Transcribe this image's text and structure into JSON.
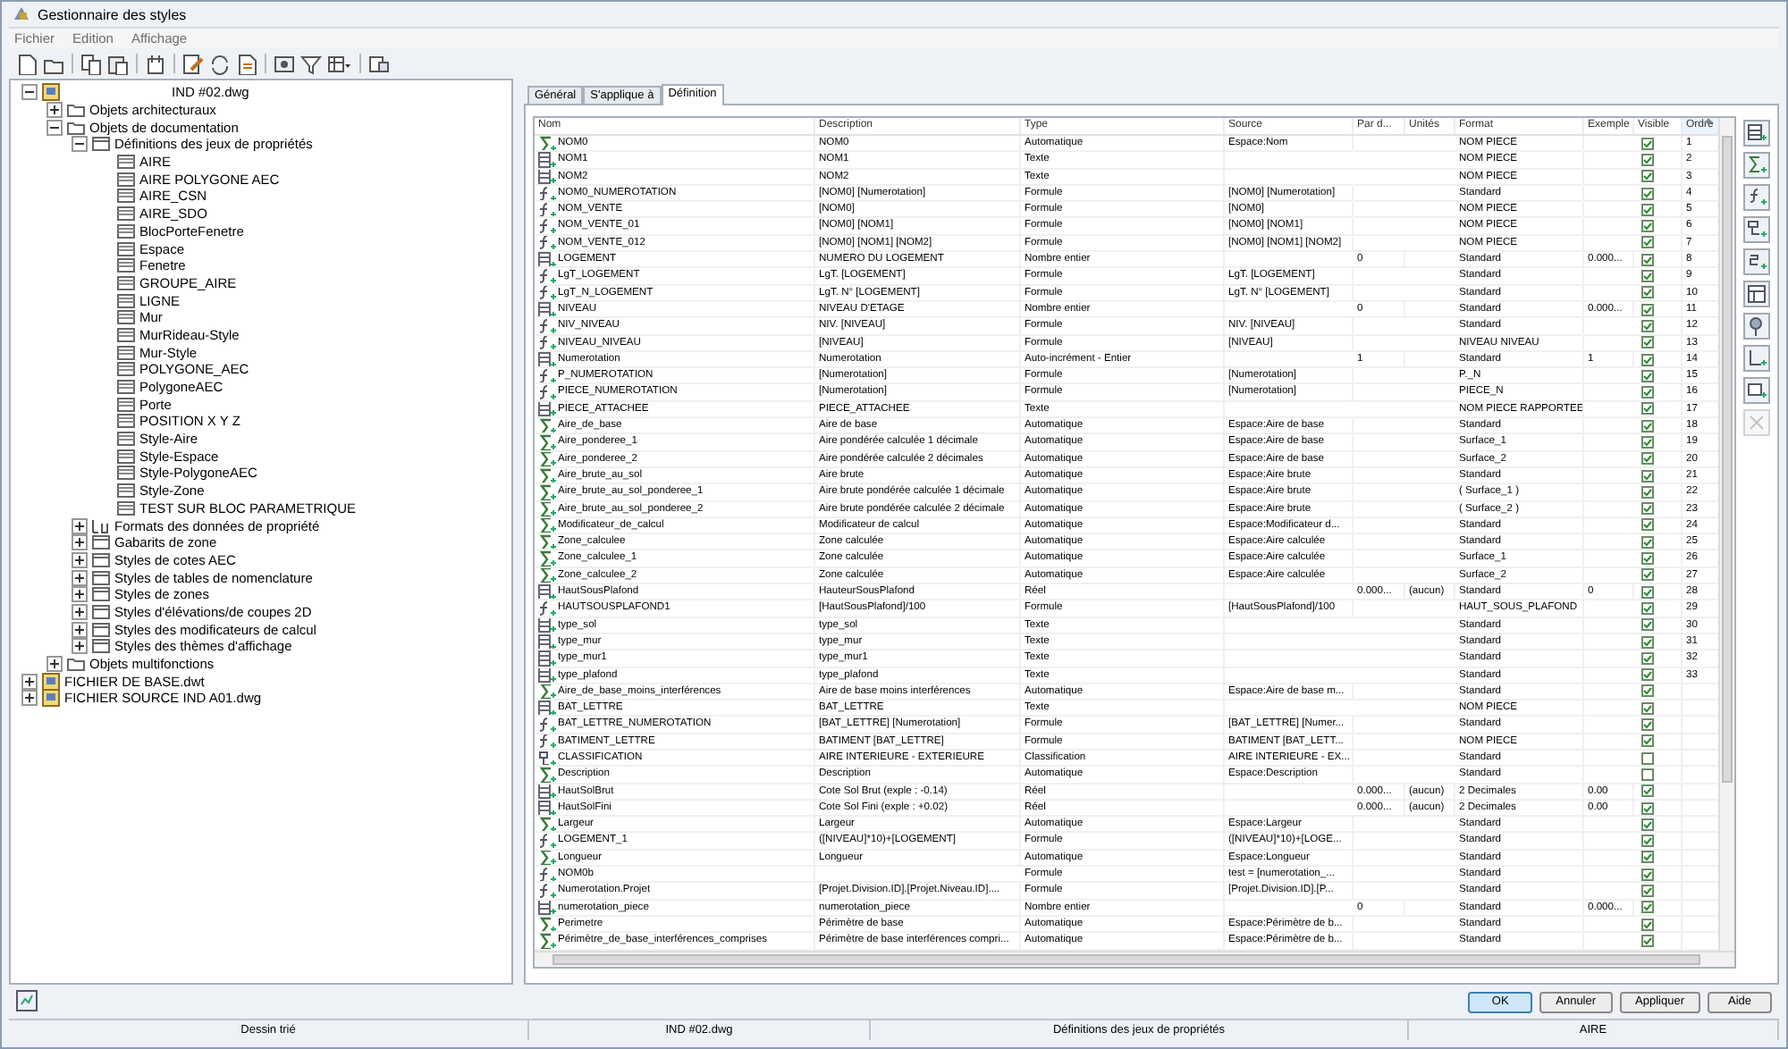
{
  "window": {
    "title": "Gestionnaire des styles"
  },
  "menu": [
    "Fichier",
    "Edition",
    "Affichage"
  ],
  "tree": [
    {
      "label": "IND #02.dwg",
      "kind": "drawing",
      "expanded": true,
      "children": [
        {
          "label": "Objets architecturaux",
          "kind": "folder",
          "expanded": false
        },
        {
          "label": "Objets de documentation",
          "kind": "folder",
          "expanded": true,
          "children": [
            {
              "label": "Définitions des jeux de propriétés",
              "kind": "category",
              "expanded": true,
              "children": [
                {
                  "label": "AIRE",
                  "kind": "item"
                },
                {
                  "label": "AIRE POLYGONE AEC",
                  "kind": "item"
                },
                {
                  "label": "AIRE_CSN",
                  "kind": "item"
                },
                {
                  "label": "AIRE_SDO",
                  "kind": "item"
                },
                {
                  "label": "BlocPorteFenetre",
                  "kind": "item"
                },
                {
                  "label": "Espace",
                  "kind": "item"
                },
                {
                  "label": "Fenetre",
                  "kind": "item"
                },
                {
                  "label": "GROUPE_AIRE",
                  "kind": "item"
                },
                {
                  "label": "LIGNE",
                  "kind": "item"
                },
                {
                  "label": "Mur",
                  "kind": "item"
                },
                {
                  "label": "MurRideau-Style",
                  "kind": "item"
                },
                {
                  "label": "Mur-Style",
                  "kind": "item"
                },
                {
                  "label": "POLYGONE_AEC",
                  "kind": "item"
                },
                {
                  "label": "PolygoneAEC",
                  "kind": "item"
                },
                {
                  "label": "Porte",
                  "kind": "item"
                },
                {
                  "label": "POSITION X Y Z",
                  "kind": "item"
                },
                {
                  "label": "Style-Aire",
                  "kind": "item"
                },
                {
                  "label": "Style-Espace",
                  "kind": "item"
                },
                {
                  "label": "Style-PolygoneAEC",
                  "kind": "item"
                },
                {
                  "label": "Style-Zone",
                  "kind": "item"
                },
                {
                  "label": "TEST SUR BLOC PARAMETRIQUE",
                  "kind": "item"
                }
              ]
            },
            {
              "label": "Formats des données de propriété",
              "kind": "format",
              "expanded": false
            },
            {
              "label": "Gabarits de zone",
              "kind": "category",
              "expanded": false
            },
            {
              "label": "Styles de cotes AEC",
              "kind": "category",
              "expanded": false
            },
            {
              "label": "Styles de tables de nomenclature",
              "kind": "category",
              "expanded": false
            },
            {
              "label": "Styles de zones",
              "kind": "category",
              "expanded": false
            },
            {
              "label": "Styles d'élévations/de coupes 2D",
              "kind": "category",
              "expanded": false
            },
            {
              "label": "Styles des modificateurs de calcul",
              "kind": "category",
              "expanded": false
            },
            {
              "label": "Styles des thèmes d'affichage",
              "kind": "category",
              "expanded": false
            }
          ]
        },
        {
          "label": "Objets multifonctions",
          "kind": "folder",
          "expanded": false
        }
      ]
    },
    {
      "label": "FICHIER DE BASE.dwt",
      "kind": "drawing",
      "expanded": false
    },
    {
      "label": "FICHIER SOURCE IND A01.dwg",
      "kind": "drawing",
      "expanded": false
    }
  ],
  "tabs": [
    {
      "label": "Général",
      "selected": false
    },
    {
      "label": "S'applique à",
      "selected": false
    },
    {
      "label": "Définition",
      "selected": true
    }
  ],
  "table": {
    "columns": [
      {
        "label": "Nom",
        "sorted": false
      },
      {
        "label": "Description",
        "sorted": false
      },
      {
        "label": "Type",
        "sorted": false
      },
      {
        "label": "Source",
        "sorted": false
      },
      {
        "label": "Par d...",
        "sorted": false
      },
      {
        "label": "Unités",
        "sorted": false
      },
      {
        "label": "Format",
        "sorted": false
      },
      {
        "label": "Exemple",
        "sorted": false
      },
      {
        "label": "Visible",
        "sorted": false
      },
      {
        "label": "Ordre",
        "sorted": true
      }
    ],
    "rows": [
      {
        "kind": "automatic",
        "name": "NOM0",
        "description": "NOM0",
        "type": "Automatique",
        "source": "Espace:Nom",
        "format": "NOM PIECE",
        "visible": true,
        "order": "1"
      },
      {
        "kind": "manual",
        "name": "NOM1",
        "description": "NOM1",
        "type": "Texte",
        "format": "NOM PIECE",
        "visible": true,
        "order": "2"
      },
      {
        "kind": "manual",
        "name": "NOM2",
        "description": "NOM2",
        "type": "Texte",
        "format": "NOM PIECE",
        "visible": true,
        "order": "3"
      },
      {
        "kind": "formula",
        "name": "NOM0_NUMEROTATION",
        "description": "[NOM0] [Numerotation]",
        "type": "Formule",
        "source": "[NOM0] [Numerotation]",
        "format": "Standard",
        "visible": true,
        "order": "4"
      },
      {
        "kind": "formula",
        "name": "NOM_VENTE",
        "description": "[NOM0]",
        "type": "Formule",
        "source": "[NOM0]",
        "format": "NOM PIECE",
        "visible": true,
        "order": "5"
      },
      {
        "kind": "formula",
        "name": "NOM_VENTE_01",
        "description": "[NOM0] [NOM1]",
        "type": "Formule",
        "source": "[NOM0] [NOM1]",
        "format": "NOM PIECE",
        "visible": true,
        "order": "6"
      },
      {
        "kind": "formula",
        "name": "NOM_VENTE_012",
        "description": "[NOM0] [NOM1] [NOM2]",
        "type": "Formule",
        "source": "[NOM0] [NOM1] [NOM2]",
        "format": "NOM PIECE",
        "visible": true,
        "order": "7"
      },
      {
        "kind": "manual",
        "name": "LOGEMENT",
        "description": "NUMERO DU LOGEMENT",
        "type": "Nombre entier",
        "default": "0",
        "format": "Standard",
        "example": "0.000...",
        "visible": true,
        "order": "8"
      },
      {
        "kind": "formula",
        "name": "LgT_LOGEMENT",
        "description": "LgT. [LOGEMENT]",
        "type": "Formule",
        "source": "LgT. [LOGEMENT]",
        "format": "Standard",
        "visible": true,
        "order": "9"
      },
      {
        "kind": "formula",
        "name": "LgT_N_LOGEMENT",
        "description": "LgT. N° [LOGEMENT]",
        "type": "Formule",
        "source": "LgT. N° [LOGEMENT]",
        "format": "Standard",
        "visible": true,
        "order": "10"
      },
      {
        "kind": "manual",
        "name": "NIVEAU",
        "description": "NIVEAU D'ETAGE",
        "type": "Nombre entier",
        "default": "0",
        "format": "Standard",
        "example": "0.000...",
        "visible": true,
        "order": "11"
      },
      {
        "kind": "formula",
        "name": "NIV_NIVEAU",
        "description": "NIV. [NIVEAU]",
        "type": "Formule",
        "source": "NIV. [NIVEAU]",
        "format": "Standard",
        "visible": true,
        "order": "12"
      },
      {
        "kind": "formula",
        "name": "NIVEAU_NIVEAU",
        "description": "[NIVEAU]",
        "type": "Formule",
        "source": "[NIVEAU]",
        "format": "NIVEAU NIVEAU",
        "visible": true,
        "order": "13"
      },
      {
        "kind": "manual",
        "name": "Numerotation",
        "description": "Numerotation",
        "type": "Auto-incrément - Entier",
        "default": "1",
        "format": "Standard",
        "example": "1",
        "visible": true,
        "order": "14"
      },
      {
        "kind": "formula",
        "name": "P_NUMEROTATION",
        "description": "[Numerotation]",
        "type": "Formule",
        "source": "[Numerotation]",
        "format": "P._N",
        "visible": true,
        "order": "15"
      },
      {
        "kind": "formula",
        "name": "PIECE_NUMEROTATION",
        "description": "[Numerotation]",
        "type": "Formule",
        "source": "[Numerotation]",
        "format": "PIECE_N",
        "visible": true,
        "order": "16"
      },
      {
        "kind": "manual",
        "name": "PIECE_ATTACHEE",
        "description": "PIECE_ATTACHEE",
        "type": "Texte",
        "format": "NOM PIECE RAPPORTEE",
        "visible": true,
        "order": "17"
      },
      {
        "kind": "automatic",
        "name": "Aire_de_base",
        "description": "Aire de base",
        "type": "Automatique",
        "source": "Espace:Aire de base",
        "format": "Standard",
        "visible": true,
        "order": "18"
      },
      {
        "kind": "automatic",
        "name": "Aire_ponderee_1",
        "description": "Aire pondérée calculée 1 décimale",
        "type": "Automatique",
        "source": "Espace:Aire de base",
        "format": "Surface_1",
        "visible": true,
        "order": "19"
      },
      {
        "kind": "automatic",
        "name": "Aire_ponderee_2",
        "description": "Aire pondérée calculée 2 décimales",
        "type": "Automatique",
        "source": "Espace:Aire de base",
        "format": "Surface_2",
        "visible": true,
        "order": "20"
      },
      {
        "kind": "automatic",
        "name": "Aire_brute_au_sol",
        "description": "Aire brute",
        "type": "Automatique",
        "source": "Espace:Aire brute",
        "format": "Standard",
        "visible": true,
        "order": "21"
      },
      {
        "kind": "automatic",
        "name": "Aire_brute_au_sol_ponderee_1",
        "description": "Aire brute pondérée calculée 1 décimale",
        "type": "Automatique",
        "source": "Espace:Aire brute",
        "format": "( Surface_1 )",
        "visible": true,
        "order": "22"
      },
      {
        "kind": "automatic",
        "name": "Aire_brute_au_sol_ponderee_2",
        "description": "Aire brute pondérée calculée 2 décimale",
        "type": "Automatique",
        "source": "Espace:Aire brute",
        "format": "( Surface_2 )",
        "visible": true,
        "order": "23"
      },
      {
        "kind": "automatic",
        "name": "Modificateur_de_calcul",
        "description": "Modificateur de calcul",
        "type": "Automatique",
        "source": "Espace:Modificateur d...",
        "format": "Standard",
        "visible": true,
        "order": "24"
      },
      {
        "kind": "automatic",
        "name": "Zone_calculee",
        "description": "Zone calculée",
        "type": "Automatique",
        "source": "Espace:Aire calculée",
        "format": "Standard",
        "visible": true,
        "order": "25"
      },
      {
        "kind": "automatic",
        "name": "Zone_calculee_1",
        "description": "Zone calculée",
        "type": "Automatique",
        "source": "Espace:Aire calculée",
        "format": "Surface_1",
        "visible": true,
        "order": "26"
      },
      {
        "kind": "automatic",
        "name": "Zone_calculee_2",
        "description": "Zone calculée",
        "type": "Automatique",
        "source": "Espace:Aire calculée",
        "format": "Surface_2",
        "visible": true,
        "order": "27"
      },
      {
        "kind": "manual",
        "name": "HautSousPlafond",
        "description": "HauteurSousPlafond",
        "type": "Réel",
        "default": "0.000...",
        "units": "(aucun)",
        "format": "Standard",
        "example": "0",
        "visible": true,
        "order": "28"
      },
      {
        "kind": "formula",
        "name": "HAUTSOUSPLAFOND1",
        "description": "[HautSousPlafond]/100",
        "type": "Formule",
        "source": "[HautSousPlafond]/100",
        "format": "HAUT_SOUS_PLAFOND",
        "visible": true,
        "order": "29"
      },
      {
        "kind": "manual",
        "name": "type_sol",
        "description": "type_sol",
        "type": "Texte",
        "format": "Standard",
        "visible": true,
        "order": "30"
      },
      {
        "kind": "manual",
        "name": "type_mur",
        "description": "type_mur",
        "type": "Texte",
        "format": "Standard",
        "visible": true,
        "order": "31"
      },
      {
        "kind": "manual",
        "name": "type_mur1",
        "description": "type_mur1",
        "type": "Texte",
        "format": "Standard",
        "visible": true,
        "order": "32"
      },
      {
        "kind": "manual",
        "name": "type_plafond",
        "description": "type_plafond",
        "type": "Texte",
        "format": "Standard",
        "visible": true,
        "order": "33"
      },
      {
        "kind": "automatic",
        "name": "Aire_de_base_moins_interférences",
        "description": "Aire de base moins interférences",
        "type": "Automatique",
        "source": "Espace:Aire de base m...",
        "format": "Standard",
        "visible": true
      },
      {
        "kind": "manual",
        "name": "BAT_LETTRE",
        "description": "BAT_LETTRE",
        "type": "Texte",
        "format": "NOM PIECE",
        "visible": true
      },
      {
        "kind": "formula",
        "name": "BAT_LETTRE_NUMEROTATION",
        "description": "[BAT_LETTRE] [Numerotation]",
        "type": "Formule",
        "source": "[BAT_LETTRE] [Numer...",
        "format": "Standard",
        "visible": true
      },
      {
        "kind": "formula",
        "name": "BATIMENT_LETTRE",
        "description": "BATIMENT [BAT_LETTRE]",
        "type": "Formule",
        "source": "BATIMENT [BAT_LETT...",
        "format": "NOM PIECE",
        "visible": true
      },
      {
        "kind": "classification",
        "name": "CLASSIFICATION",
        "description": "AIRE INTERIEURE - EXTERIEURE",
        "type": "Classification",
        "source": "AIRE INTERIEURE - EX...",
        "format": "Standard",
        "visible": false
      },
      {
        "kind": "automatic",
        "name": "Description",
        "description": "Description",
        "type": "Automatique",
        "source": "Espace:Description",
        "format": "Standard",
        "visible": false
      },
      {
        "kind": "manual",
        "name": "HautSolBrut",
        "description": "Cote Sol Brut (exple : -0.14)",
        "type": "Réel",
        "default": "0.000...",
        "units": "(aucun)",
        "format": "2 Decimales",
        "example": "0.00",
        "visible": true
      },
      {
        "kind": "manual",
        "name": "HautSolFini",
        "description": "Cote Sol Fini (exple : +0.02)",
        "type": "Réel",
        "default": "0.000...",
        "units": "(aucun)",
        "format": "2 Decimales",
        "example": "0.00",
        "visible": true
      },
      {
        "kind": "automatic",
        "name": "Largeur",
        "description": "Largeur",
        "type": "Automatique",
        "source": "Espace:Largeur",
        "format": "Standard",
        "visible": true
      },
      {
        "kind": "formula",
        "name": "LOGEMENT_1",
        "description": "([NIVEAU]*10)+[LOGEMENT]",
        "type": "Formule",
        "source": "([NIVEAU]*10)+[LOGE...",
        "format": "Standard",
        "visible": true
      },
      {
        "kind": "automatic",
        "name": "Longueur",
        "description": "Longueur",
        "type": "Automatique",
        "source": "Espace:Longueur",
        "format": "Standard",
        "visible": true
      },
      {
        "kind": "formula",
        "name": "NOM0b",
        "type": "Formule",
        "source": "test = [numerotation_...",
        "format": "Standard",
        "visible": true
      },
      {
        "kind": "formula",
        "name": "Numerotation.Projet",
        "description": "[Projet.Division.ID].[Projet.Niveau.ID]....",
        "type": "Formule",
        "source": "[Projet.Division.ID].[P...",
        "format": "Standard",
        "visible": true
      },
      {
        "kind": "manual",
        "name": "numerotation_piece",
        "description": "numerotation_piece",
        "type": "Nombre entier",
        "default": "0",
        "format": "Standard",
        "example": "0.000...",
        "visible": true
      },
      {
        "kind": "automatic",
        "name": "Perimetre",
        "description": "Périmètre de base",
        "type": "Automatique",
        "source": "Espace:Périmètre de b...",
        "format": "Standard",
        "visible": true
      },
      {
        "kind": "automatic",
        "name": "Périmètre_de_base_interférences_comprises",
        "description": "Périmètre de base interférences compri...",
        "type": "Automatique",
        "source": "Espace:Périmètre de b...",
        "format": "Standard",
        "visible": true
      }
    ]
  },
  "side_tools": [
    {
      "kind": "manual",
      "disabled": false
    },
    {
      "kind": "automatic",
      "disabled": false
    },
    {
      "kind": "formula",
      "disabled": false
    },
    {
      "kind": "classification",
      "disabled": false
    },
    {
      "kind": "number",
      "disabled": false
    },
    {
      "kind": "table",
      "disabled": false
    },
    {
      "kind": "location",
      "disabled": false
    },
    {
      "kind": "graphic",
      "disabled": false
    },
    {
      "kind": "material",
      "disabled": false
    },
    {
      "kind": "delete",
      "disabled": true
    }
  ],
  "buttons": [
    {
      "label": "OK",
      "default": true
    },
    {
      "label": "Annuler",
      "default": false
    },
    {
      "label": "Appliquer",
      "default": false
    },
    {
      "label": "Aide",
      "default": false
    }
  ],
  "status_bar": [
    "Dessin trié",
    "IND #02.dwg",
    "Définitions des jeux de propriétés",
    "AIRE"
  ]
}
